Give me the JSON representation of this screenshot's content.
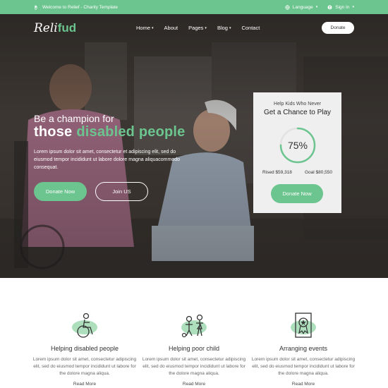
{
  "topbar": {
    "welcome": "Welcome to Relief - Charity Template",
    "language": "Language",
    "signin": "Sign In"
  },
  "nav": {
    "logo_main": "Reli",
    "logo_accent": "fud",
    "items": [
      "Home",
      "About",
      "Pages",
      "Blog",
      "Contact"
    ],
    "donate": "Donate"
  },
  "hero": {
    "subtitle": "Be a champion for",
    "title_white": "those",
    "title_green": "disabled people",
    "text": "Lorem ipsum dolor sit amet, consectetur et adipiscing elit, sed do eiusmod tempor incididunt ut labore dolore magna aliquacommodo consequat.",
    "btn_donate": "Donate Now",
    "btn_join": "Join US"
  },
  "card": {
    "line1": "Help Kids Who Never",
    "line2": "Get a Chance to Play",
    "progress": 75,
    "progress_label": "75%",
    "raised": "Rised $59,318",
    "goal": "Goal $80,550",
    "btn": "Donate Now"
  },
  "features": [
    {
      "title": "Helping disabled people",
      "text": "Lorem ipsum dolor sit amet, consectetur adipiscing elit, sed do eiusmod tempor incididunt ut labore for the dolore magna aliqua.",
      "more": "Read More",
      "icon": "wheelchair-icon"
    },
    {
      "title": "Helping poor child",
      "text": "Lorem ipsum dolor sit amet, consectetur adipiscing elit, sed do eiusmod tempor incididunt ut labore for the dolore magna aliqua.",
      "more": "Read More",
      "icon": "children-icon"
    },
    {
      "title": "Arranging events",
      "text": "Lorem ipsum dolor sit amet, consectetur adipiscing elit, sed do eiusmod tempor incididunt ut labore for the dolore magna aliqua.",
      "more": "Read More",
      "icon": "award-icon"
    }
  ],
  "colors": {
    "accent": "#6cc48f",
    "card_bg": "#efefef"
  }
}
